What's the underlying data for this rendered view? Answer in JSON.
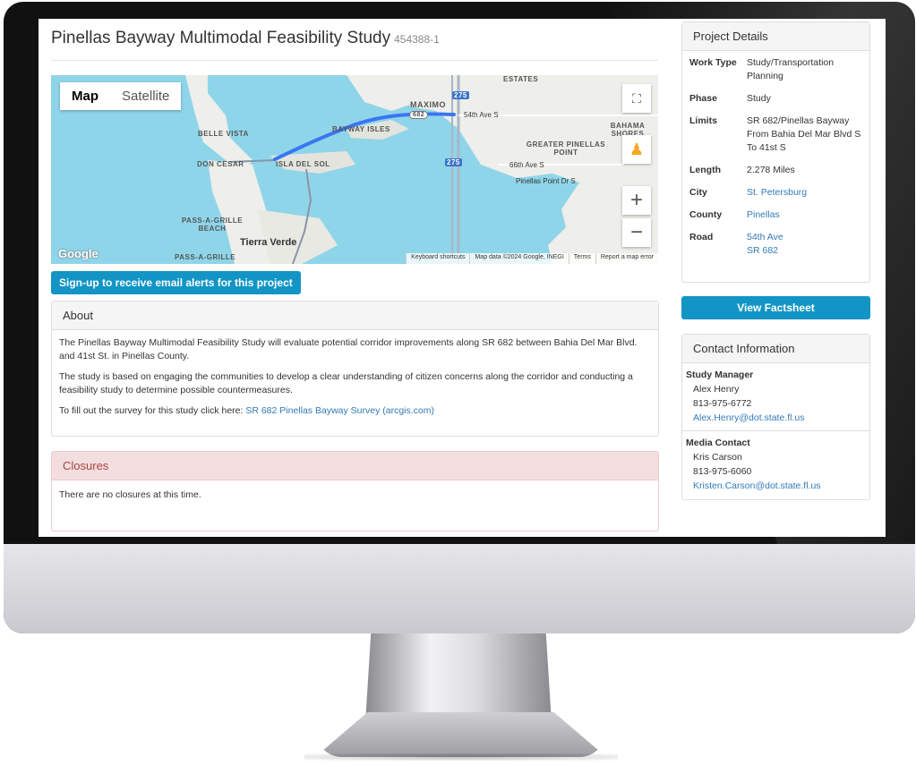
{
  "page": {
    "title": "Pinellas Bayway Multimodal Feasibility Study",
    "project_id": "454388-1"
  },
  "map": {
    "type_map": "Map",
    "type_satellite": "Satellite",
    "labels": {
      "estates": "ESTATES",
      "maximo": "MAXIMO",
      "belle_vista": "BELLE VISTA",
      "bayway_isles": "BAYWAY ISLES",
      "don_cesar": "DON CESAR",
      "isla_del_sol": "ISLA DEL SOL",
      "greater_pinellas": "GREATER PINELLAS POINT",
      "bahama_shores": "BAHAMA SHORES",
      "pass_a_grille_beach": "PASS-A-GRILLE BEACH",
      "tierra_verde": "Tierra Verde",
      "pass_a_grille": "PASS-A-GRILLE",
      "ave_54": "54th Ave S",
      "ave_66": "66th Ave S",
      "pinellas_point_dr": "Pinellas Point Dr S",
      "i275_a": "275",
      "i275_b": "275",
      "sr682": "682"
    },
    "logo": "Google",
    "footer": {
      "shortcuts": "Keyboard shortcuts",
      "data": "Map data ©2024 Google, INEGI",
      "terms": "Terms",
      "report": "Report a map error"
    },
    "icons": {
      "fullscreen": "fullscreen-icon",
      "pegman": "pegman-icon",
      "zoom_in": "+",
      "zoom_out": "−"
    }
  },
  "signup_label": "Sign-up to receive email alerts for this project",
  "about": {
    "heading": "About",
    "p1": "The Pinellas Bayway Multimodal Feasibility Study will evaluate potential corridor improvements along SR 682 between Bahia Del Mar Blvd. and 41st St. in Pinellas County.",
    "p2": "The study is based on engaging the communities to develop a clear understanding of citizen concerns along the corridor and conducting a feasibility study to determine possible countermeasures.",
    "p3_prefix": "To fill out the survey for this study click here:",
    "p3_link": "SR 682 Pinellas Bayway Survey (arcgis.com)"
  },
  "closures": {
    "heading": "Closures",
    "body": "There are no closures at this time."
  },
  "details": {
    "heading": "Project Details",
    "work_type_label": "Work Type",
    "work_type": "Study/Transportation Planning",
    "phase_label": "Phase",
    "phase": "Study",
    "limits_label": "Limits",
    "limits": "SR 682/Pinellas Bayway From Bahia Del Mar Blvd S To 41st S",
    "length_label": "Length",
    "length": "2.278 Miles",
    "city_label": "City",
    "city": "St. Petersburg",
    "county_label": "County",
    "county": "Pinellas",
    "road_label": "Road",
    "roads": [
      "54th Ave",
      "SR 682"
    ]
  },
  "factsheet_label": "View Factsheet",
  "contact": {
    "heading": "Contact Information",
    "manager_role": "Study Manager",
    "manager_name": "Alex Henry",
    "manager_phone": "813-975-6772",
    "manager_email": "Alex.Henry@dot.state.fl.us",
    "media_role": "Media Contact",
    "media_name": "Kris Carson",
    "media_phone": "813-975-6060",
    "media_email": "Kristen.Carson@dot.state.fl.us"
  },
  "colors": {
    "accent": "#1295c5",
    "link": "#337ab7",
    "water": "#8fd5ea",
    "land": "#eeeeea",
    "route": "#3a76f0",
    "closures_bg": "#f2dede"
  }
}
